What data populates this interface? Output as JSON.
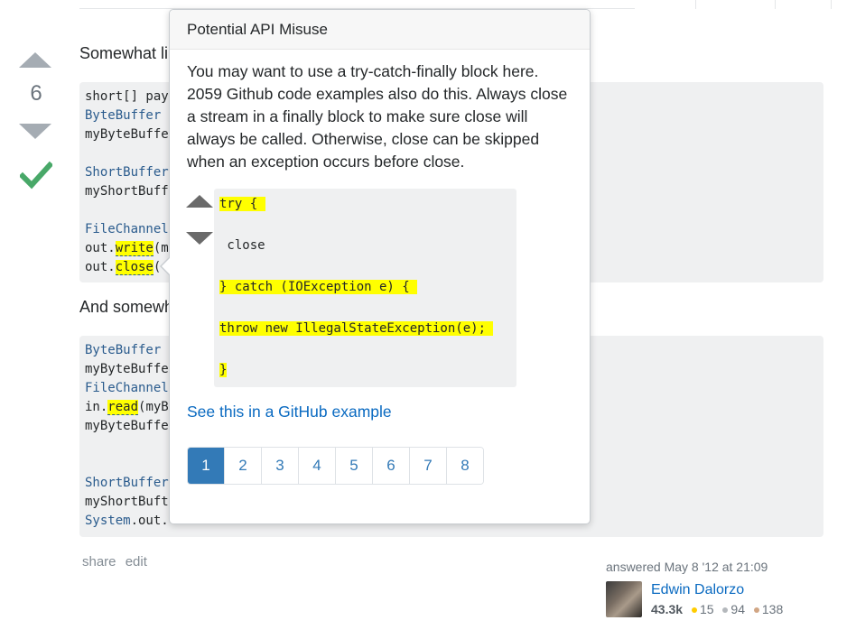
{
  "vote": {
    "count": "6"
  },
  "post": {
    "intro_text": "Somewhat li",
    "block1_lines": [
      [
        {
          "t": "short[] pay",
          "c": ""
        }
      ],
      [
        {
          "t": "ByteBuffer ",
          "c": "kw"
        }
      ],
      [
        {
          "t": "myByteBuffe",
          "c": ""
        }
      ],
      [
        {
          "t": "",
          "c": ""
        }
      ],
      [
        {
          "t": "ShortBuffer",
          "c": "kw"
        }
      ],
      [
        {
          "t": "myShortBuff",
          "c": ""
        }
      ],
      [
        {
          "t": "",
          "c": ""
        }
      ],
      [
        {
          "t": "FileChannel",
          "c": "kw"
        },
        {
          "t": "                                                   ();",
          "c": ""
        }
      ],
      [
        {
          "t": "out.",
          "c": ""
        },
        {
          "t": "write",
          "c": "hl hl-u"
        },
        {
          "t": "(m",
          "c": ""
        }
      ],
      [
        {
          "t": "out.",
          "c": ""
        },
        {
          "t": "close",
          "c": "hl hl-u"
        },
        {
          "t": "(",
          "c": ""
        }
      ]
    ],
    "middle_text": "And somewh",
    "block2_lines": [
      [
        {
          "t": "ByteBuffer ",
          "c": "kw"
        }
      ],
      [
        {
          "t": "myByteBuffe",
          "c": ""
        }
      ],
      [
        {
          "t": "FileChannel",
          "c": "kw"
        },
        {
          "t": "                                                   ;",
          "c": ""
        }
      ],
      [
        {
          "t": "in.",
          "c": ""
        },
        {
          "t": "read",
          "c": "hl hl-u"
        },
        {
          "t": "(myB",
          "c": ""
        }
      ],
      [
        {
          "t": "myByteBuffe",
          "c": ""
        }
      ],
      [
        {
          "t": "",
          "c": ""
        }
      ],
      [
        {
          "t": "",
          "c": ""
        }
      ],
      [
        {
          "t": "ShortBuffer",
          "c": "kw"
        }
      ],
      [
        {
          "t": "myShortBuft",
          "c": ""
        }
      ],
      [
        {
          "t": "System",
          "c": "kw"
        },
        {
          "t": ".out.",
          "c": ""
        }
      ]
    ],
    "menu": {
      "share": "share",
      "edit": "edit"
    }
  },
  "signature": {
    "action": "answered May 8 '12 at 21:09",
    "user_name": "Edwin Dalorzo",
    "reputation": "43.3k",
    "gold": "15",
    "silver": "94",
    "bronze": "138",
    "colors": {
      "gold": "#ffcc01",
      "silver": "#b4b8bc",
      "bronze": "#d1a684"
    }
  },
  "popover": {
    "title": "Potential API Misuse",
    "body": "You may want to use a try-catch-finally block here. 2059 Github code examples also do this. Always close a stream in a finally block to make sure close will always be called. Otherwise, close can be skipped when an exception occurs before close.",
    "example_lines": [
      {
        "text": "try { ",
        "highlight": true
      },
      {
        "text": " close",
        "highlight": false
      },
      {
        "text": "} catch (IOException e) { ",
        "highlight": true
      },
      {
        "text": "throw new IllegalStateException(e); ",
        "highlight": true
      },
      {
        "text": "}",
        "highlight": true
      }
    ],
    "github_link": "See this in a GitHub example",
    "pages": [
      "1",
      "2",
      "3",
      "4",
      "5",
      "6",
      "7",
      "8"
    ],
    "active_page": "1"
  }
}
